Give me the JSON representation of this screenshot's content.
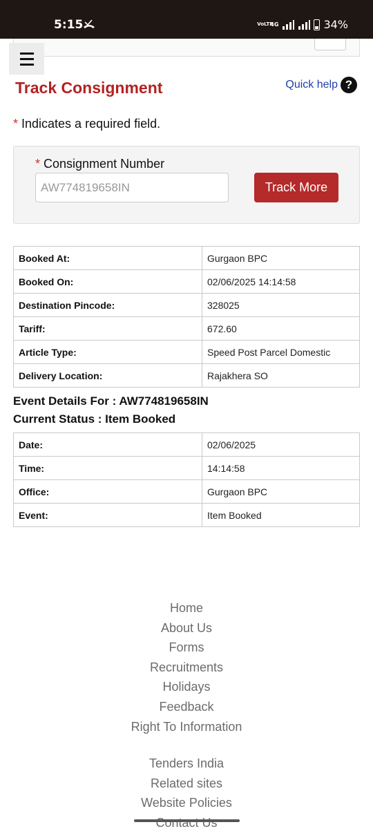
{
  "status_bar": {
    "time": "5:15",
    "volte": "VoLTE",
    "network": "4G",
    "battery": "34%"
  },
  "header": {
    "page_title": "Track Consignment",
    "quick_help": "Quick help",
    "help_icon_glyph": "?"
  },
  "required_note": {
    "star": "*",
    "text": " Indicates a required field."
  },
  "form": {
    "label_star": "*",
    "label": " Consignment Number",
    "value": "AW774819658IN",
    "button": "Track More"
  },
  "booking_details": [
    {
      "label": "Booked At:",
      "value": "Gurgaon BPC"
    },
    {
      "label": "Booked On:",
      "value": "02/06/2025 14:14:58"
    },
    {
      "label": "Destination Pincode:",
      "value": "328025"
    },
    {
      "label": "Tariff:",
      "value": "672.60"
    },
    {
      "label": "Article Type:",
      "value": "Speed Post Parcel Domestic"
    },
    {
      "label": "Delivery Location:",
      "value": "Rajakhera SO"
    }
  ],
  "event_details_heading": "Event Details For : AW774819658IN",
  "current_status_heading": "Current Status : Item Booked",
  "event_details": [
    {
      "label": "Date:",
      "value": "02/06/2025"
    },
    {
      "label": "Time:",
      "value": "14:14:58"
    },
    {
      "label": "Office:",
      "value": "Gurgaon BPC"
    },
    {
      "label": "Event:",
      "value": "Item Booked"
    }
  ],
  "footer": {
    "group1": [
      "Home",
      "About Us",
      "Forms",
      "Recruitments",
      "Holidays",
      "Feedback",
      "Right To Information"
    ],
    "group2": [
      "Tenders India",
      "Related sites",
      "Website Policies",
      "Contact Us"
    ]
  },
  "colors": {
    "status_bar_bg": "#1f1713",
    "title_red": "#b22222",
    "button_red": "#b52a2a",
    "link_blue": "#1f3fa8",
    "footer_gray": "#6b6b6b"
  }
}
